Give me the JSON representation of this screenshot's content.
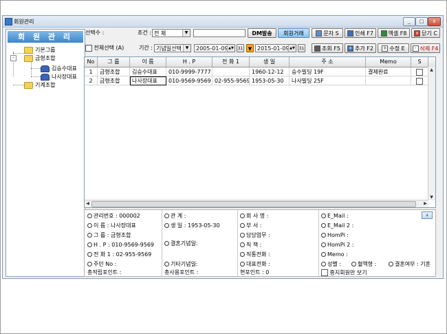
{
  "window": {
    "title": "회원관리",
    "minimize": "_",
    "maximize": "□",
    "close": "x"
  },
  "left": {
    "header": "회 원 관 리",
    "tree": [
      {
        "label": "기본그룹",
        "icon": "folder-icon"
      },
      {
        "label": "금형조합",
        "icon": "folder-icon",
        "expander": "-"
      },
      {
        "label": "김승수대표",
        "icon": "people-icon"
      },
      {
        "label": "나사장대표",
        "icon": "people-icon"
      },
      {
        "label": "기계조합",
        "icon": "folder-icon"
      }
    ]
  },
  "toolbar": {
    "select_count_label": "선택수 :",
    "condition_label": "조건 :",
    "condition_value": "전      체",
    "search_value": "",
    "dm_btn": "DM발송",
    "member_btn": "회원거래",
    "sms_btn": "문자 S",
    "print_btn": "인쇄 F7",
    "excel_btn": "엑셀 F8",
    "close_btn": "닫기 C",
    "select_all_label": "전체선택 (A)",
    "period_label": "기간 :",
    "period_value": "기념일선택",
    "date_from": "2005-01-09",
    "date_to": "2015-01-09",
    "date_from_cal": "31",
    "date_to_cal": "31",
    "query_btn": "조회 F5",
    "add_btn": "추가 F2",
    "edit_btn": "수정 E",
    "delete_btn": "삭제 F4"
  },
  "grid": {
    "columns": [
      "No",
      "그    룹",
      "이    름",
      "H . P",
      "전 화 1",
      "생    일",
      "주          소",
      "Memo",
      "S"
    ],
    "rows": [
      [
        "1",
        "금형조합",
        "김승수대표",
        "010-9999-7777",
        "",
        "1960-12-12",
        "승수빌딩 19F",
        "결제완료",
        ""
      ],
      [
        "2",
        "금형조합",
        "나사장대표",
        "010-9569-9569",
        "02-955-9569",
        "1953-05-30",
        "나사빌딩 25F",
        "",
        ""
      ]
    ]
  },
  "detail": {
    "info_btn": "↓",
    "col1": [
      "관리번호 : 000002",
      "이    름 : 나사장대표",
      "그    룹 : 금형조합",
      "H  .  P : 010-9569-9569",
      "전 화 1 : 02-955-9569",
      "주민  No :",
      "총적립포인트 :"
    ],
    "col2": [
      "관        계 :",
      "생        일 :   1953-05-30",
      "결혼기념일:",
      "기타기념일:",
      "총사용포인트 :"
    ],
    "col3": [
      "회 사 명 :",
      "부      서 :",
      "담당업무 :",
      "직      책 :",
      "직통전화 :",
      "대표전화 :",
      "현포인트 : 0"
    ],
    "col4": [
      "E_Mail    :",
      "E_Mail 2 :",
      "HomPi    :",
      "HomPi 2 :",
      "Memo     :"
    ],
    "gender": "성별 :",
    "blood": "혈액형 :",
    "marriage": "결혼여부 : 기혼",
    "stop_label": "중지회원만 보기"
  }
}
